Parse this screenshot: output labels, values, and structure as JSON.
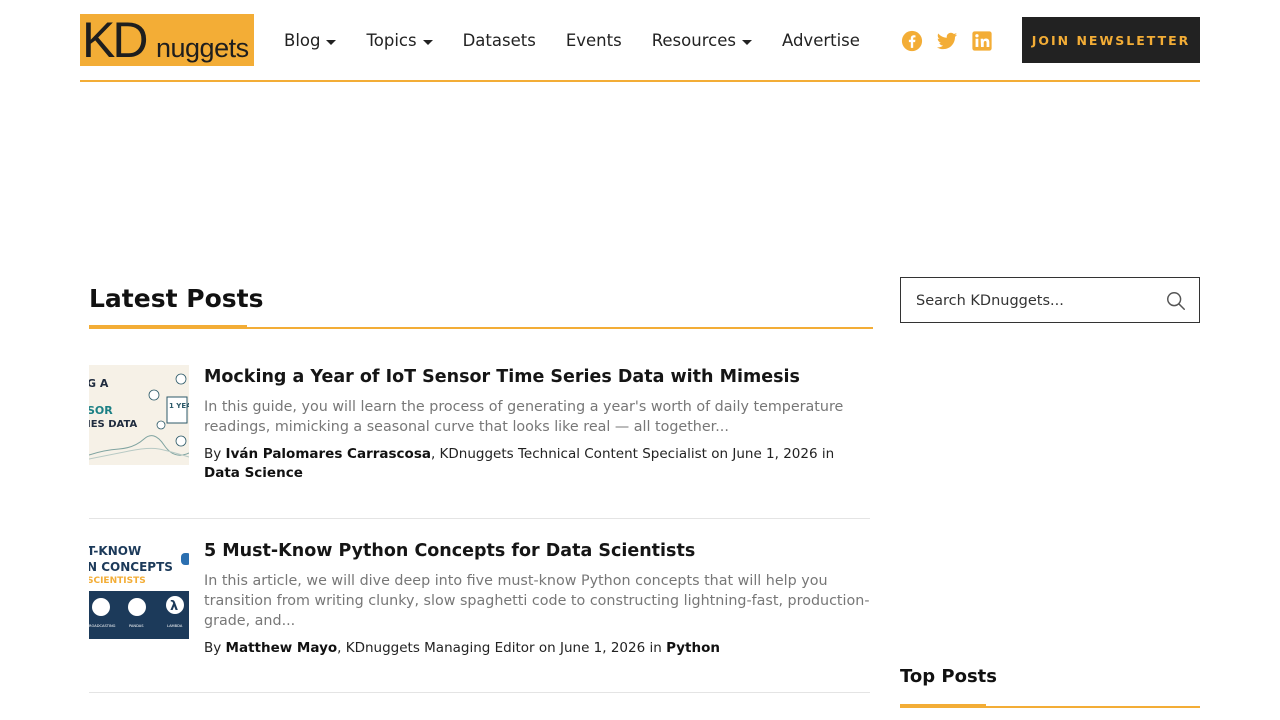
{
  "logo": {
    "kd": "KD",
    "nuggets": "nuggets"
  },
  "nav": [
    {
      "label": "Blog",
      "has_dropdown": true
    },
    {
      "label": "Topics",
      "has_dropdown": true
    },
    {
      "label": "Datasets",
      "has_dropdown": false
    },
    {
      "label": "Events",
      "has_dropdown": false
    },
    {
      "label": "Resources",
      "has_dropdown": true
    },
    {
      "label": "Advertise",
      "has_dropdown": false
    }
  ],
  "social": [
    "facebook-icon",
    "twitter-icon",
    "linkedin-icon"
  ],
  "join_button": "JOIN NEWSLETTER",
  "colors": {
    "accent": "#f3ad36",
    "dark": "#222222",
    "muted_text": "#777777"
  },
  "main": {
    "section_title": "Latest Posts",
    "posts": [
      {
        "title": "Mocking a Year of IoT Sensor Time Series Data with Mimesis",
        "excerpt": "In this guide, you will learn the process of generating a year's worth of daily temperature readings, mimicking a seasonal curve that looks like real — all together...",
        "by": "By ",
        "author": "Iván Palomares Carrascosa",
        "role": ", KDnuggets Technical Content Specialist on June 1, 2026 in ",
        "category": "Data Science",
        "thumb": {
          "line1": "G A",
          "line2": "SOR",
          "line3": "IES DATA",
          "badge": "1 YEA"
        }
      },
      {
        "title": "5 Must-Know Python Concepts for Data Scientists",
        "excerpt": "In this article, we will dive deep into five must-know Python concepts that will help you transition from writing clunky, slow spaghetti code to constructing lightning-fast, production-grade, and...",
        "by": "By ",
        "author": "Matthew Mayo",
        "role": ", KDnuggets Managing Editor on June 1, 2026 in ",
        "category": "Python",
        "thumb": {
          "line1": "T-KNOW",
          "line2": "N CONCEPTS",
          "line3": "SCIENTISTS",
          "cap1": "ROADCASTING",
          "cap2": "PANDAS",
          "cap3": "LAMBDA"
        }
      }
    ]
  },
  "sidebar": {
    "search_placeholder": "Search KDnuggets...",
    "top_posts_title": "Top Posts"
  }
}
